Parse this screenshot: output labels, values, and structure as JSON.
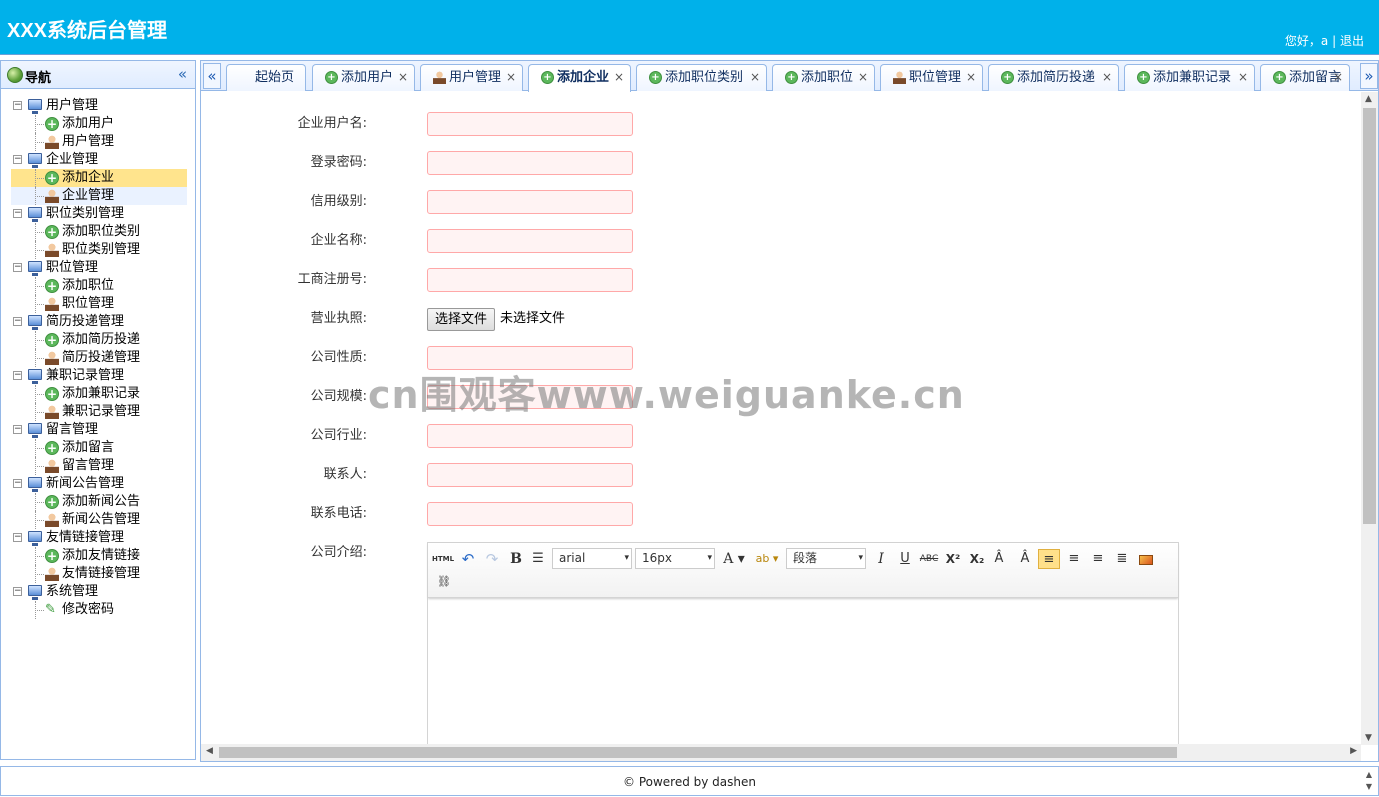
{
  "header": {
    "title": "XXX系统后台管理",
    "greeting": "您好，a",
    "separator": "|",
    "logout": "退出"
  },
  "west": {
    "title": "导航",
    "tree": [
      {
        "type": "group",
        "label": "用户管理"
      },
      {
        "type": "leaf",
        "icon": "add-icon",
        "label": "添加用户"
      },
      {
        "type": "leaf",
        "icon": "user-icon",
        "label": "用户管理"
      },
      {
        "type": "group",
        "label": "企业管理"
      },
      {
        "type": "leaf",
        "icon": "add-icon",
        "label": "添加企业",
        "selected": true
      },
      {
        "type": "leaf",
        "icon": "user-icon",
        "label": "企业管理",
        "hover": true
      },
      {
        "type": "group",
        "label": "职位类别管理"
      },
      {
        "type": "leaf",
        "icon": "add-icon",
        "label": "添加职位类别"
      },
      {
        "type": "leaf",
        "icon": "user-icon",
        "label": "职位类别管理"
      },
      {
        "type": "group",
        "label": "职位管理"
      },
      {
        "type": "leaf",
        "icon": "add-icon",
        "label": "添加职位"
      },
      {
        "type": "leaf",
        "icon": "user-icon",
        "label": "职位管理"
      },
      {
        "type": "group",
        "label": "简历投递管理"
      },
      {
        "type": "leaf",
        "icon": "add-icon",
        "label": "添加简历投递"
      },
      {
        "type": "leaf",
        "icon": "user-icon",
        "label": "简历投递管理"
      },
      {
        "type": "group",
        "label": "兼职记录管理"
      },
      {
        "type": "leaf",
        "icon": "add-icon",
        "label": "添加兼职记录"
      },
      {
        "type": "leaf",
        "icon": "user-icon",
        "label": "兼职记录管理"
      },
      {
        "type": "group",
        "label": "留言管理"
      },
      {
        "type": "leaf",
        "icon": "add-icon",
        "label": "添加留言"
      },
      {
        "type": "leaf",
        "icon": "user-icon",
        "label": "留言管理"
      },
      {
        "type": "group",
        "label": "新闻公告管理"
      },
      {
        "type": "leaf",
        "icon": "add-icon",
        "label": "添加新闻公告"
      },
      {
        "type": "leaf",
        "icon": "user-icon",
        "label": "新闻公告管理"
      },
      {
        "type": "group",
        "label": "友情链接管理"
      },
      {
        "type": "leaf",
        "icon": "add-icon",
        "label": "添加友情链接"
      },
      {
        "type": "leaf",
        "icon": "user-icon",
        "label": "友情链接管理"
      },
      {
        "type": "group",
        "label": "系统管理"
      },
      {
        "type": "leaf",
        "icon": "pencil-icon",
        "label": "修改密码"
      }
    ]
  },
  "tabs": [
    {
      "label": "起始页",
      "icon": "",
      "closable": false
    },
    {
      "label": "添加用户",
      "icon": "add-icon",
      "closable": true
    },
    {
      "label": "用户管理",
      "icon": "user-icon",
      "closable": true
    },
    {
      "label": "添加企业",
      "icon": "add-icon",
      "closable": true,
      "active": true
    },
    {
      "label": "添加职位类别",
      "icon": "add-icon",
      "closable": true
    },
    {
      "label": "添加职位",
      "icon": "add-icon",
      "closable": true
    },
    {
      "label": "职位管理",
      "icon": "user-icon",
      "closable": true
    },
    {
      "label": "添加简历投递",
      "icon": "add-icon",
      "closable": true
    },
    {
      "label": "添加兼职记录",
      "icon": "add-icon",
      "closable": true
    },
    {
      "label": "添加留言",
      "icon": "add-icon",
      "closable": true
    }
  ],
  "tab_close_glyph": "×",
  "form": {
    "fields": [
      {
        "label": "企业用户名:",
        "type": "text",
        "value": ""
      },
      {
        "label": "登录密码:",
        "type": "text",
        "value": ""
      },
      {
        "label": "信用级别:",
        "type": "text",
        "value": ""
      },
      {
        "label": "企业名称:",
        "type": "text",
        "value": ""
      },
      {
        "label": "工商注册号:",
        "type": "text",
        "value": ""
      },
      {
        "label": "营业执照:",
        "type": "file",
        "button": "选择文件",
        "status": "未选择文件"
      },
      {
        "label": "公司性质:",
        "type": "text",
        "value": ""
      },
      {
        "label": "公司规模:",
        "type": "text",
        "value": ""
      },
      {
        "label": "公司行业:",
        "type": "text",
        "value": ""
      },
      {
        "label": "联系人:",
        "type": "text",
        "value": ""
      },
      {
        "label": "联系电话:",
        "type": "text",
        "value": ""
      },
      {
        "label": "公司介绍:",
        "type": "editor"
      }
    ],
    "editor": {
      "html_btn": "HTML",
      "font_family": "arial",
      "font_size": "16px",
      "paragraph": "段落"
    }
  },
  "footer": {
    "text": "© Powered by dashen"
  },
  "watermark": "cn围观客www.weiguanke.cn",
  "colors": {
    "header_bg": "#00b1ea",
    "panel_border": "#95b8e7",
    "selected_node": "#ffe48d",
    "input_border": "#ffa8a8",
    "input_bg": "#fff3f3"
  }
}
